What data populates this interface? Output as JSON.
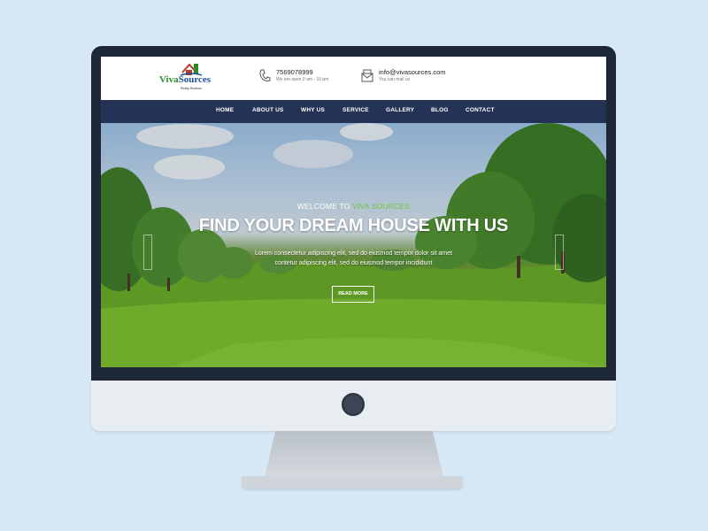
{
  "logo": {
    "brand_part1": "Viva",
    "brand_part2": "Sources",
    "tagline": "Realty Realtors"
  },
  "contact": {
    "phone": "7569078999",
    "phone_sub": "We are open 9 am - 10 pm",
    "email": "info@vivasources.com",
    "email_sub": "You can mail us"
  },
  "nav": {
    "items": [
      {
        "label": "HOME"
      },
      {
        "label": "ABOUT US"
      },
      {
        "label": "WHY US"
      },
      {
        "label": "SERVICE"
      },
      {
        "label": "GALLERY"
      },
      {
        "label": "BLOG"
      },
      {
        "label": "CONTACT"
      }
    ]
  },
  "hero": {
    "welcome_prefix": "WELCOME TO ",
    "welcome_accent": "VIVA SOURCES",
    "title": "FIND YOUR DREAM HOUSE WITH US",
    "text_line1": "Lorem consectetur adipiscing elit, sed do eiusmod tempor dolor sit amet",
    "text_line2": "contetur adipiscing elit, sed do eiusmod tempor incididunt",
    "cta_label": "READ MORE"
  },
  "colors": {
    "background": "#d6e8f6",
    "nav_bg": "#243256",
    "accent_green": "#6ec53d",
    "brand_blue": "#1d4f9c"
  }
}
